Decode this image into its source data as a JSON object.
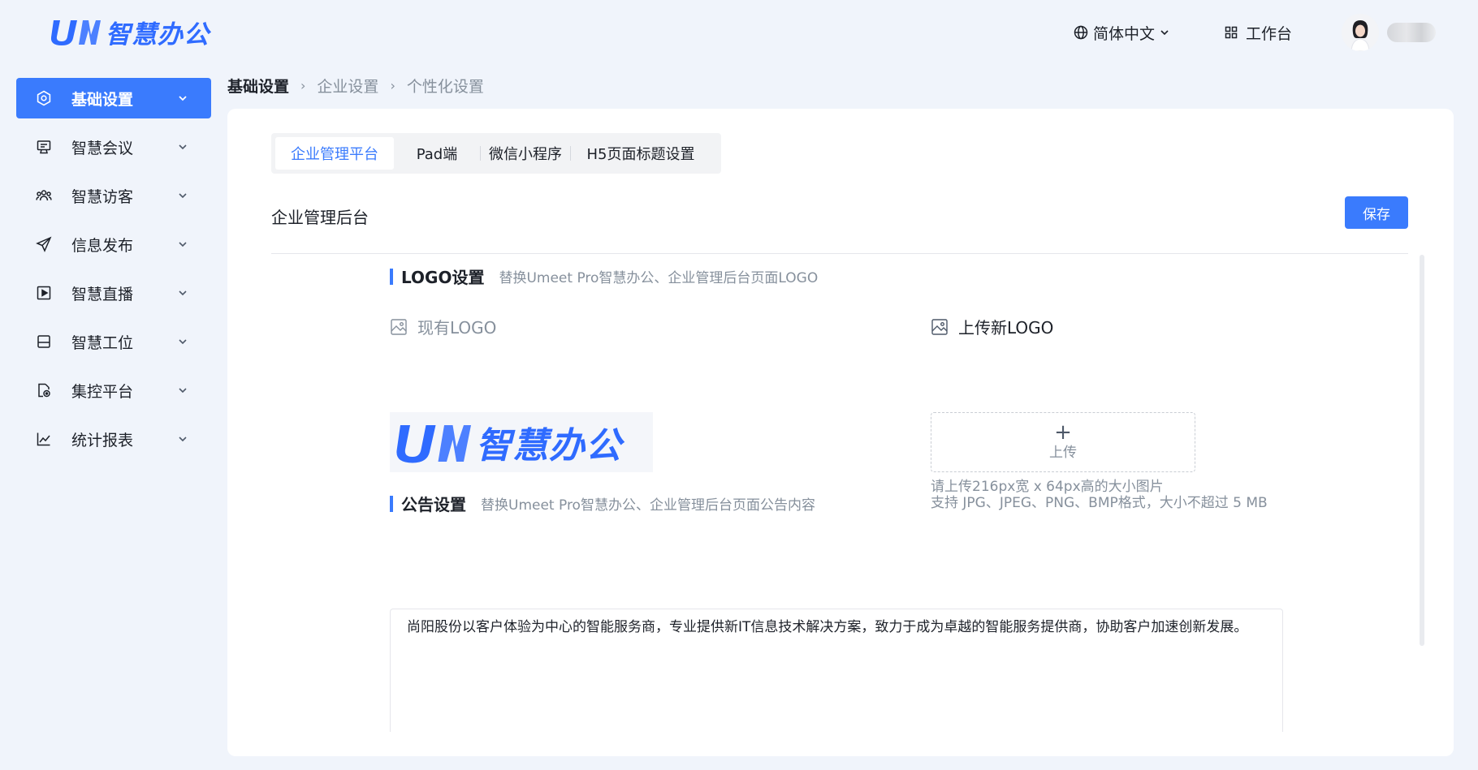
{
  "header": {
    "brand_text": "智慧办公",
    "language_label": "简体中文",
    "workbench_label": "工作台"
  },
  "sidebar": {
    "items": [
      {
        "label": "基础设置",
        "icon": "settings-icon",
        "active": true
      },
      {
        "label": "智慧会议",
        "icon": "meeting-icon"
      },
      {
        "label": "智慧访客",
        "icon": "visitor-icon"
      },
      {
        "label": "信息发布",
        "icon": "send-icon"
      },
      {
        "label": "智慧直播",
        "icon": "play-icon"
      },
      {
        "label": "智慧工位",
        "icon": "workstation-icon"
      },
      {
        "label": "集控平台",
        "icon": "control-icon"
      },
      {
        "label": "统计报表",
        "icon": "chart-icon"
      }
    ]
  },
  "breadcrumb": [
    "基础设置",
    "企业设置",
    "个性化设置"
  ],
  "tabs": [
    "企业管理平台",
    "Pad端",
    "微信小程序",
    "H5页面标题设置"
  ],
  "section": {
    "title": "企业管理后台",
    "save_label": "保存"
  },
  "logo_settings": {
    "title": "LOGO设置",
    "description": "替换Umeet Pro智慧办公、企业管理后台页面LOGO",
    "current_label": "现有LOGO",
    "upload_label": "上传新LOGO",
    "upload_button_label": "上传",
    "hint_line1": "请上传216px宽 x 64px高的大小图片",
    "hint_line2": "支持 JPG、JPEG、PNG、BMP格式，大小不超过 5 MB"
  },
  "notice_settings": {
    "title": "公告设置",
    "description": "替换Umeet Pro智慧办公、企业管理后台页面公告内容",
    "content": "尚阳股份以客户体验为中心的智能服务商，专业提供新IT信息技术解决方案，致力于成为卓越的智能服务提供商，协助客户加速创新发展。"
  },
  "colors": {
    "accent": "#3a7bfd",
    "background": "#f0f4fb",
    "muted_text": "#86909c"
  }
}
